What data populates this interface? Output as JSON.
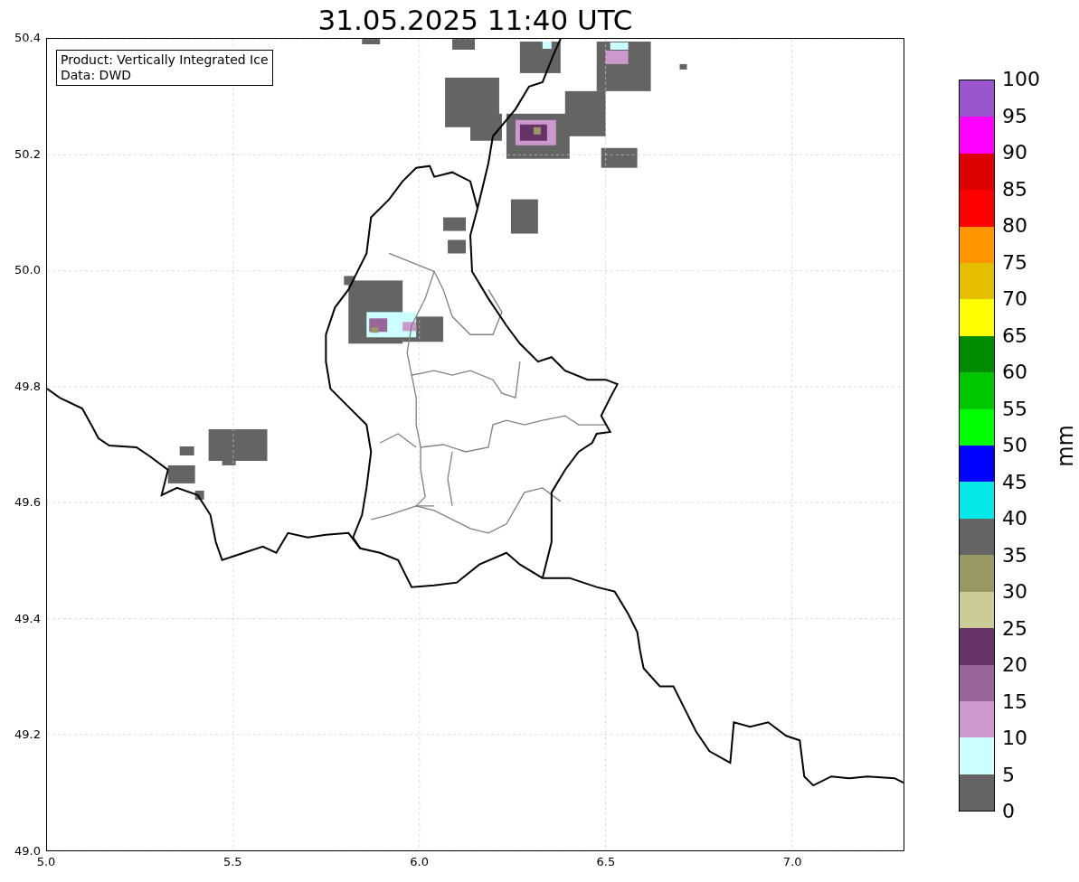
{
  "title": "31.05.2025 11:40 UTC",
  "info_box": [
    "Product: Vertically Integrated Ice",
    "Data: DWD"
  ],
  "map": {
    "yticks": [
      "50.4",
      "50.2",
      "50.0",
      "49.8",
      "49.6",
      "49.4",
      "49.2",
      "49.0"
    ],
    "xticks": [
      "5.0",
      "5.5",
      "6.0",
      "6.5",
      "7.0"
    ]
  },
  "colorbar": {
    "label": "mm",
    "colors": [
      {
        "color": "#9955cc"
      },
      {
        "color": "#ff00ff"
      },
      {
        "color": "#dc0000"
      },
      {
        "color": "#ff0000"
      },
      {
        "color": "#ff9600"
      },
      {
        "color": "#e6be00"
      },
      {
        "color": "#ffff00"
      },
      {
        "color": "#008c00"
      },
      {
        "color": "#00c800"
      },
      {
        "color": "#00ff00"
      },
      {
        "color": "#0000ff"
      },
      {
        "color": "#05e8e8"
      },
      {
        "color": "#646464"
      },
      {
        "color": "#999966"
      },
      {
        "color": "#cccc99"
      },
      {
        "color": "#663366"
      },
      {
        "color": "#996699"
      },
      {
        "color": "#cc99cc"
      },
      {
        "color": "#ccffff"
      },
      {
        "color": "#646464"
      }
    ],
    "ticks": [
      "100",
      "95",
      "90",
      "85",
      "80",
      "75",
      "70",
      "65",
      "60",
      "55",
      "50",
      "45",
      "40",
      "35",
      "30",
      "25",
      "20",
      "15",
      "10",
      "5",
      "0"
    ]
  }
}
